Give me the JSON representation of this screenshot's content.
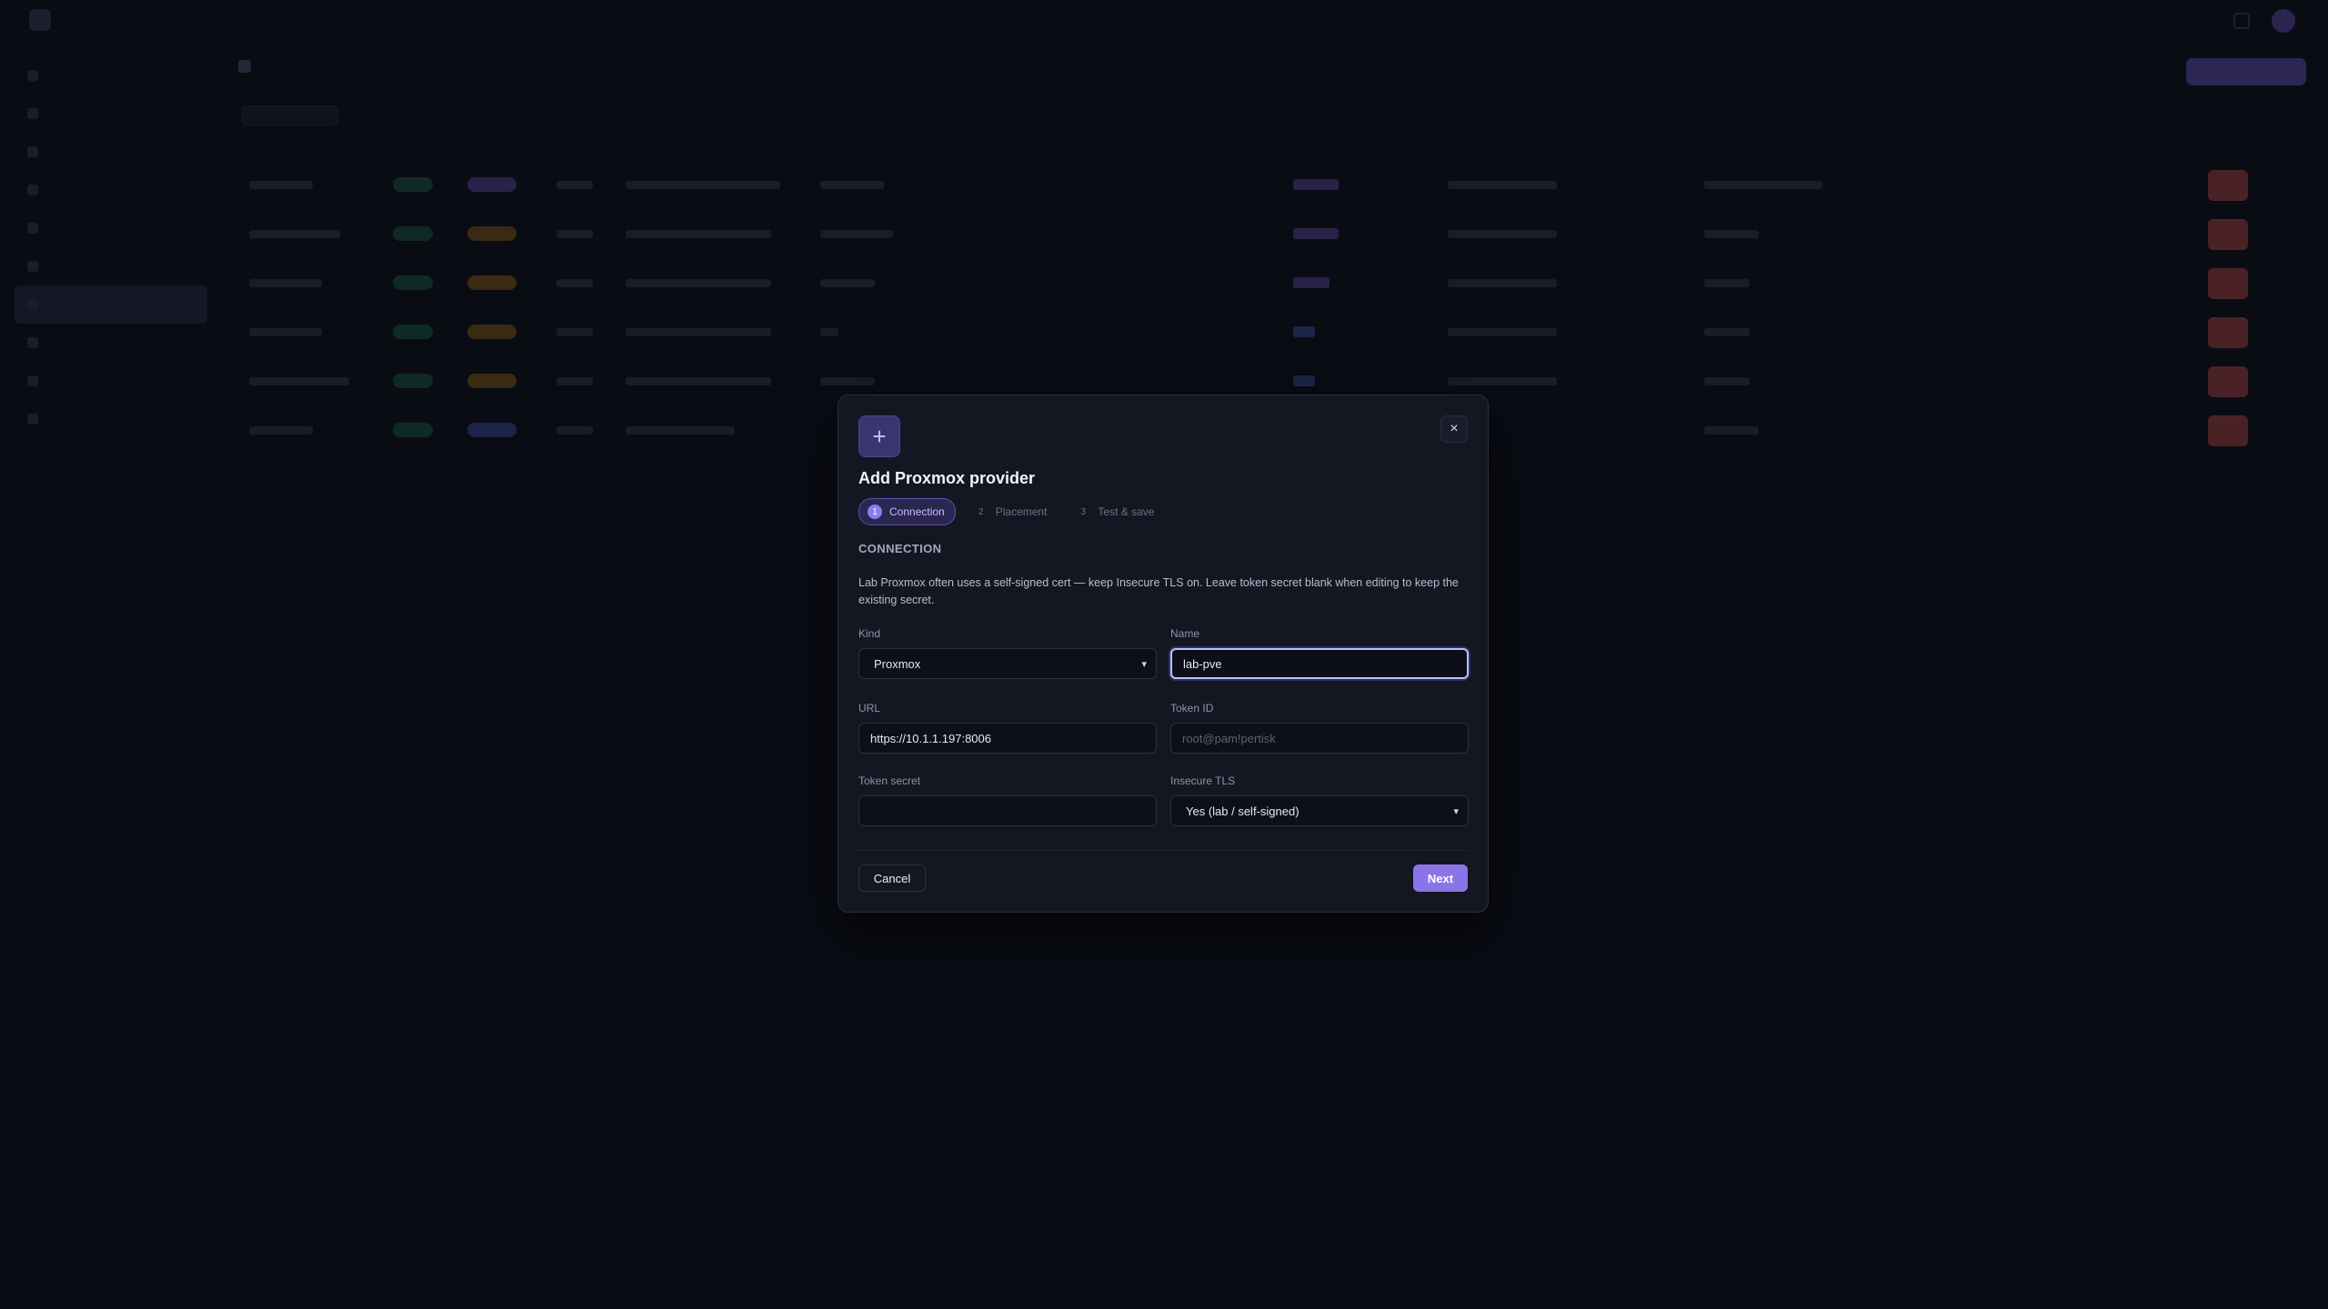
{
  "modal": {
    "title": "Add Proxmox provider",
    "close_glyph": "×",
    "header_icon": "plus-icon",
    "steps": [
      {
        "num": "1",
        "label": "Connection"
      },
      {
        "num": "2",
        "label": "Placement"
      },
      {
        "num": "3",
        "label": "Test & save"
      }
    ],
    "section_title": "CONNECTION",
    "description": "Lab Proxmox often uses a self-signed cert — keep Insecure TLS on. Leave token secret blank when editing to keep the existing secret.",
    "fields": {
      "kind": {
        "label": "Kind",
        "value": "Proxmox"
      },
      "name": {
        "label": "Name",
        "value": "lab-pve"
      },
      "url": {
        "label": "URL",
        "value": "https://10.1.1.197:8006"
      },
      "token_id": {
        "label": "Token ID",
        "placeholder": "root@pam!pertisk"
      },
      "token_secret": {
        "label": "Token secret",
        "value": ""
      },
      "insecure_tls": {
        "label": "Insecure TLS",
        "value": "Yes (lab / self-signed)"
      }
    },
    "cancel_label": "Cancel",
    "next_label": "Next",
    "accent_color": "#8b74e8"
  }
}
